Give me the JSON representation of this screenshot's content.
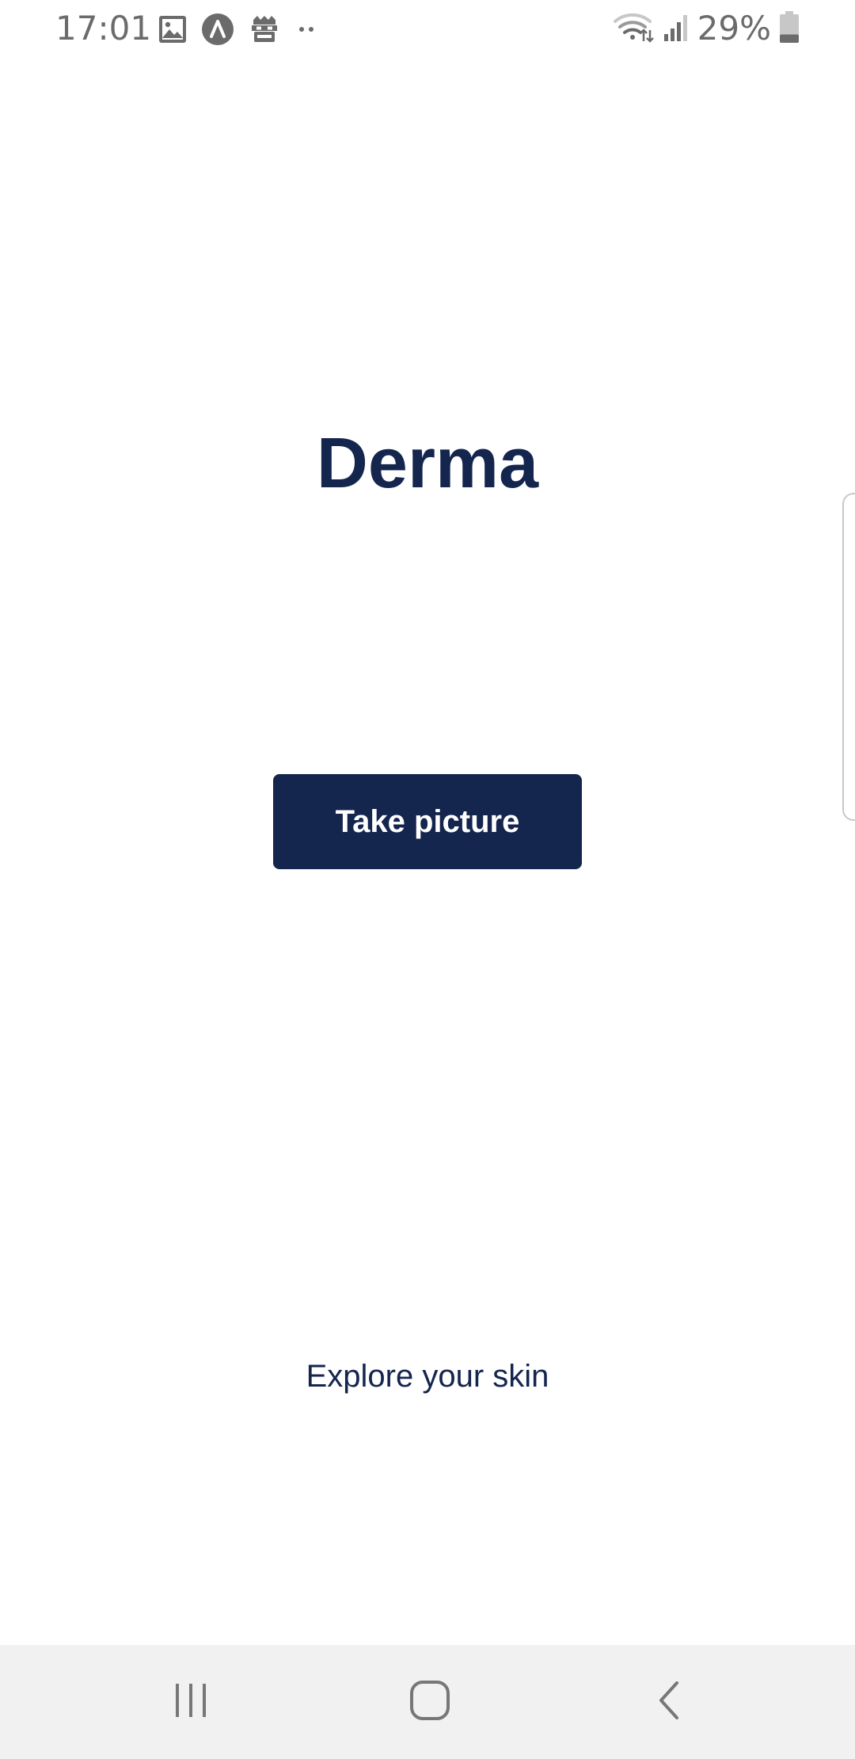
{
  "status_bar": {
    "time": "17:01",
    "battery_percent": "29%",
    "battery_level": 0.29,
    "left_icons": [
      "gallery-icon",
      "navigation-arrow-icon",
      "robot-icon",
      "more-notifications-icon"
    ],
    "right_icons": [
      "wifi-icon",
      "signal-icon",
      "battery-icon"
    ]
  },
  "main": {
    "title": "Derma",
    "button_label": "Take picture",
    "tagline": "Explore your skin"
  },
  "navigation_bar": {
    "buttons": [
      "recents-icon",
      "home-icon",
      "back-icon"
    ]
  },
  "colors": {
    "brand": "#14254e",
    "status_icons": "#6b6b6b",
    "nav_background": "#f1f1f1",
    "nav_icons": "#777777"
  }
}
